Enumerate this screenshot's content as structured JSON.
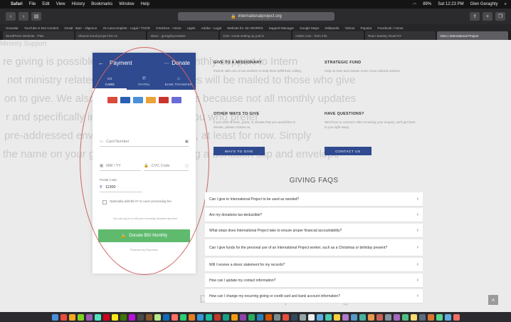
{
  "menubar": {
    "app": "Safari",
    "items": [
      "File",
      "Edit",
      "View",
      "History",
      "Bookmarks",
      "Window",
      "Help"
    ],
    "battery": "89%",
    "clock": "Sat 12:23 PM",
    "user": "Glen Geraghty"
  },
  "browser": {
    "url": "internationalproject.org",
    "bookmarks": [
      "Gravatar",
      "YouTube is Not Content",
      "Gmail - Barr - eligence",
      "JS Autocomplete - Legal / TOOR",
      "OneDrive - Home",
      "Apple",
      "Adobe - Legal",
      "Website for Jim WORRS",
      "Support Manager",
      "Google Maps",
      "Wikipedia",
      "Yahoo!",
      "Popular",
      "Facebook / Home"
    ],
    "tabs": [
      {
        "label": "WordPress Website - Plan",
        "active": false
      },
      {
        "label": "Shared email project list on",
        "active": false
      },
      {
        "label": "Inbox - geraghtycreative",
        "active": false
      },
      {
        "label": "Give: Great setting up just in",
        "active": false
      },
      {
        "label": "Aribitz.com - form info",
        "active": false
      },
      {
        "label": "Team Stanley Road NY",
        "active": false
      },
      {
        "label": "Give | International Project",
        "active": true
      }
    ]
  },
  "background_text": [
    "Ministry Support",
    "re giving is possible, please consider monthly support to Intern",
    "not ministry related. Our monthly updates will be mailed to those who give",
    "on to give. We also send Birthday notices because not all monthly updates",
    "r and specifically intended for those of you who prefer",
    "pre-addressed envelopes in our updates, at least for now. Simply",
    "the name on your gift, as we are including a donation slip and envelope",
    "Details of this updates for g"
  ],
  "payment": {
    "title": "Payment",
    "donate_label": "Donate",
    "methods": [
      {
        "label": "CARD",
        "icon": "card-icon",
        "active": true
      },
      {
        "label": "PAYPAL",
        "icon": "paypal-icon",
        "active": false
      },
      {
        "label": "BANK TRANSFER",
        "icon": "bank-icon",
        "active": false
      }
    ],
    "card_brand_colors": [
      "#d94a3a",
      "#2b5fb3",
      "#4a90d9",
      "#e8a33a",
      "#c9352d",
      "#6b6bd6"
    ],
    "card_number_placeholder": "Card Number",
    "expiry_placeholder": "MM / YY",
    "cvc_placeholder": "CVC Code",
    "postal_label": "Postal Code",
    "postal_value": "11300",
    "fee_checkbox_label": "Optionally add $2.07 to cover processing fee",
    "note": "You can log in to edit your recurring donation any time",
    "donate_button": "Donate $50 Monthly",
    "powered_by": "Powered by Donorbox"
  },
  "info_cards": {
    "missionary": {
      "title": "GIVE TO A MISSIONARY",
      "text": "Partner with one of our workers to help them fulfill their calling."
    },
    "strategic": {
      "title": "STRATEGIC FUND",
      "text": "Help us train and sustain more cross-cultural workers."
    },
    "other_ways": {
      "title": "OTHER WAYS TO GIVE",
      "text": "If you wish to learn, grant, or donate that you would like to donate, please contact us.",
      "button": "WAYS TO GIVE"
    },
    "questions": {
      "title": "HAVE QUESTIONS?",
      "text": "We'd love to connect! After receiving your enquiry, we'll get back to you right away.",
      "button": "CONTACT US"
    }
  },
  "faqs": {
    "title": "GIVING FAQS",
    "items": [
      "Can I give to International Project to be used as needed?",
      "Are my donations tax-deductible?",
      "What steps does International Project take to ensure proper financial accountability?",
      "Can I give funds for the personal use of an International Project worker, such as a Christmas or birthday present?",
      "Will I receive a donor statement for my records?",
      "How can I update my contact information?",
      "How can I change my recurring giving or credit card and bank account information?"
    ]
  },
  "scroll_top_icon": "chevron-up-icon",
  "dock_colors": [
    "#4a90d9",
    "#e94b3c",
    "#f5a623",
    "#7ed321",
    "#9b59b6",
    "#50e3c2",
    "#d0021b",
    "#f8e71c",
    "#417505",
    "#bd10e0",
    "#4a4a4a",
    "#8b572a",
    "#b8e986",
    "#0f6cbd",
    "#ff6f61",
    "#2ecc71",
    "#e67e22",
    "#3498db",
    "#1abc9c",
    "#c0392b",
    "#16a085",
    "#f39c12",
    "#8e44ad",
    "#27ae60",
    "#2980b9",
    "#d35400",
    "#7f8c8d",
    "#e74c3c",
    "#34495e",
    "#95a5a6",
    "#ecf0f1",
    "#5dade2",
    "#48c9b0",
    "#f4d03f",
    "#af7ac5",
    "#5499c7",
    "#45b39d",
    "#eb984e",
    "#cd6155",
    "#85929e",
    "#a569bd",
    "#52be80",
    "#f7dc6f",
    "#5d6d7e",
    "#dc7633",
    "#58d68d",
    "#5dade2",
    "#ec7063"
  ]
}
